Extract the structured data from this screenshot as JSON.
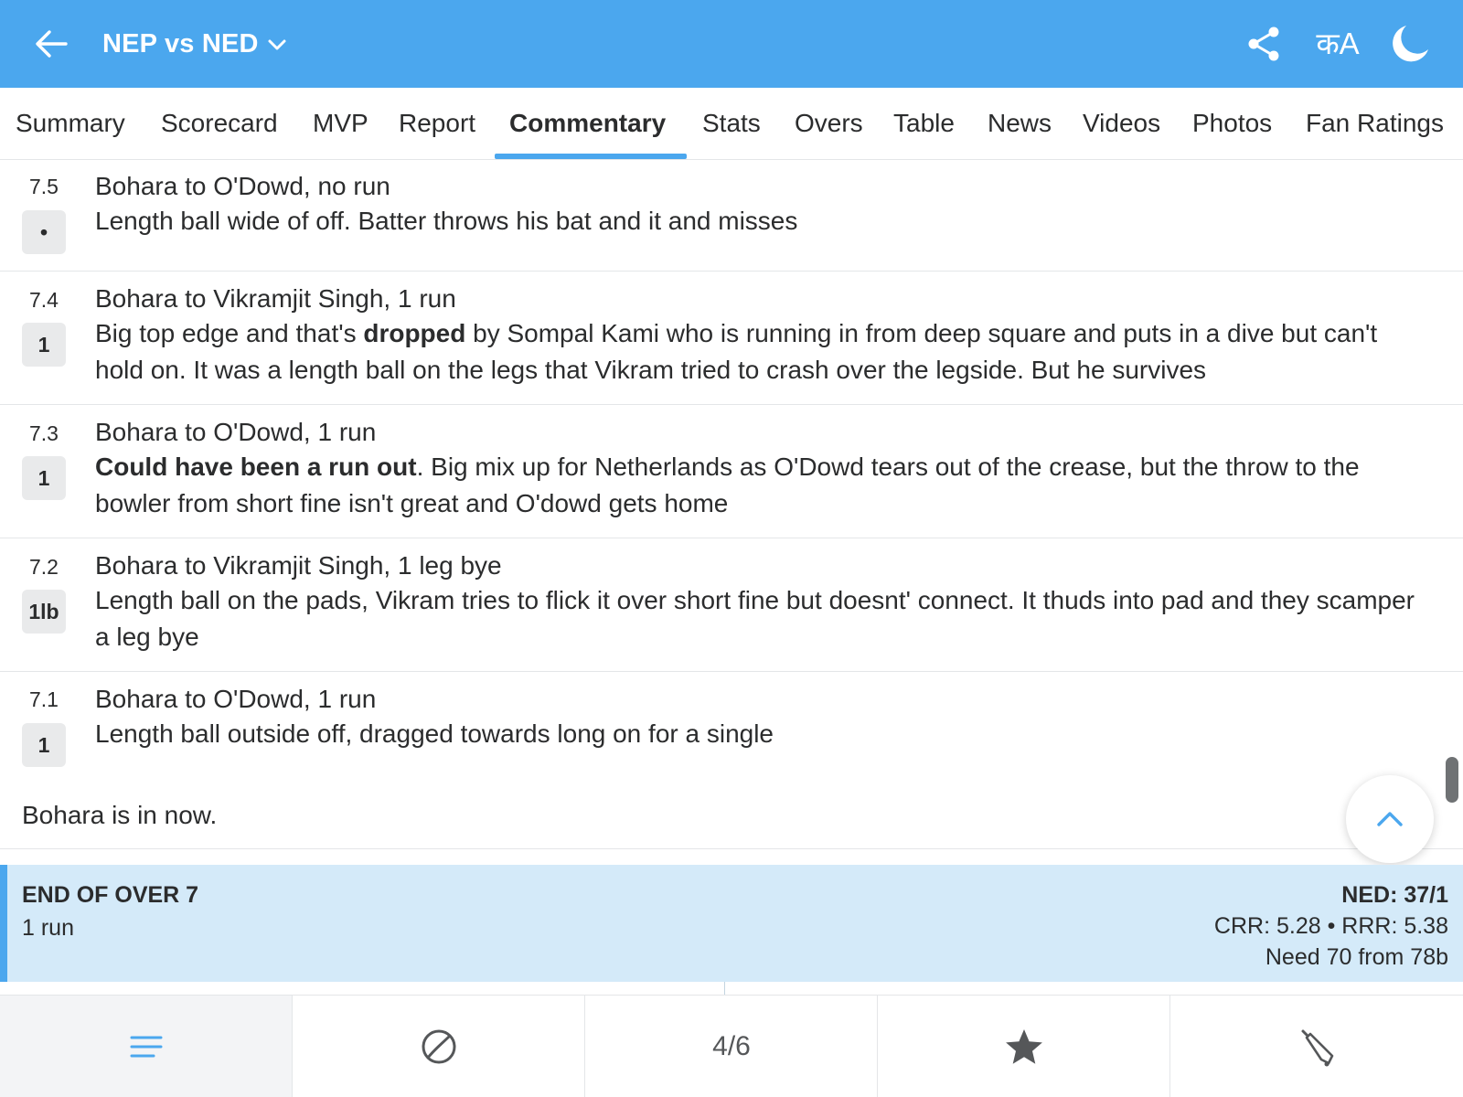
{
  "header": {
    "title": "NEP vs NED",
    "lang_toggle": "कA",
    "icons": [
      "back-arrow-icon",
      "chevron-down-icon",
      "share-icon",
      "language-icon",
      "moon-icon"
    ],
    "background_color": "#4ba7ee"
  },
  "tabs": [
    {
      "label": "Summary"
    },
    {
      "label": "Scorecard"
    },
    {
      "label": "MVP"
    },
    {
      "label": "Report"
    },
    {
      "label": "Commentary",
      "active": true
    },
    {
      "label": "Stats"
    },
    {
      "label": "Overs"
    },
    {
      "label": "Table"
    },
    {
      "label": "News"
    },
    {
      "label": "Videos"
    },
    {
      "label": "Photos"
    },
    {
      "label": "Fan Ratings"
    }
  ],
  "commentary": [
    {
      "over": "7.5",
      "result": "•",
      "headline": "Bohara to O'Dowd, no run",
      "text_bold": "",
      "text_rest": "Length ball wide of off. Batter throws his bat and it and misses"
    },
    {
      "over": "7.4",
      "result": "1",
      "headline": "Bohara to Vikramjit Singh, 1 run",
      "text_pre": "Big top edge and that's ",
      "text_bold": "dropped",
      "text_rest": " by Sompal Kami who is running in from deep square and puts in a dive but can't hold on. It was a length ball on the legs that Vikram tried to crash over the legside. But he survives"
    },
    {
      "over": "7.3",
      "result": "1",
      "headline": "Bohara to O'Dowd, 1 run",
      "text_pre": "",
      "text_bold": "Could have been a run out",
      "text_rest": ". Big mix up for Netherlands as O'Dowd tears out of the crease, but the throw to the bowler from short fine isn't great and O'dowd gets home"
    },
    {
      "over": "7.2",
      "result": "1lb",
      "headline": "Bohara to Vikramjit Singh, 1 leg bye",
      "text_bold": "",
      "text_rest": "Length ball on the pads, Vikram tries to flick it over short fine but doesnt' connect. It thuds into pad and they scamper a leg bye"
    },
    {
      "over": "7.1",
      "result": "1",
      "headline": "Bohara to O'Dowd, 1 run",
      "text_bold": "",
      "text_rest": "Length ball outside off, dragged towards long on for a single"
    }
  ],
  "note": "Bohara is in now.",
  "end_of_over": {
    "title": "END OF OVER 7",
    "runs": "1 run",
    "score": "NED: 37/1",
    "rates": "CRR: 5.28 • RRR: 5.38",
    "need": "Need 70 from 78b"
  },
  "bottom_nav": {
    "page_indicator": "4/6",
    "icons": [
      "menu-lines-icon",
      "ball-icon",
      "star-icon",
      "bat-icon"
    ]
  }
}
